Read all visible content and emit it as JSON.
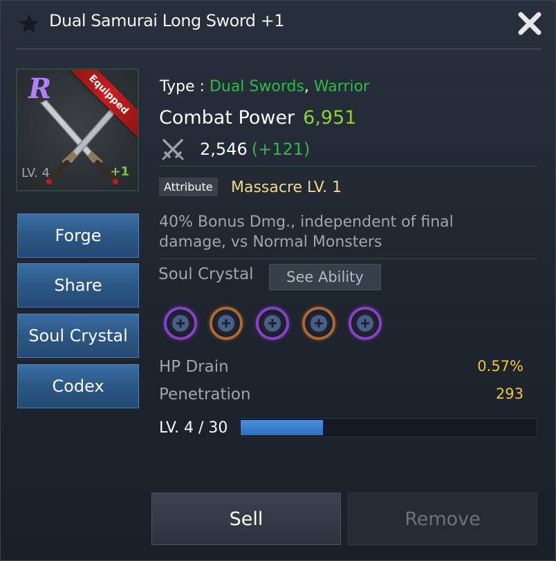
{
  "header": {
    "title": "Dual Samurai Long Sword +1"
  },
  "item": {
    "rarity": "R",
    "equipped_label": "Equipped",
    "level": "LV. 4",
    "enhance": "+1"
  },
  "left_buttons": [
    {
      "label": "Forge"
    },
    {
      "label": "Share"
    },
    {
      "label": "Soul Crystal"
    },
    {
      "label": "Codex"
    }
  ],
  "info": {
    "type_label": "Type :",
    "type_value": "Dual Swords",
    "type_separator": ",",
    "class_value": "Warrior",
    "combat_power_label": "Combat Power",
    "combat_power_value": "6,951",
    "attack_value": "2,546",
    "attack_bonus": "(+121)"
  },
  "attribute": {
    "badge": "Attribute",
    "value": "Massacre LV. 1",
    "description": "40% Bonus Dmg., independent of final damage, vs Normal Monsters"
  },
  "soul_crystal": {
    "label": "Soul Crystal",
    "see_ability_label": "See Ability",
    "slots": [
      "purple",
      "orange",
      "purple",
      "orange",
      "purple"
    ]
  },
  "stats": [
    {
      "name": "HP Drain",
      "value": "0.57%"
    },
    {
      "name": "Penetration",
      "value": "293"
    }
  ],
  "exp": {
    "label": "LV. 4 / 30",
    "progress": 0.28
  },
  "actions": {
    "sell_label": "Sell",
    "remove_label": "Remove"
  },
  "colors": {
    "accent_green": "#33b84a",
    "combat_green": "#8fd13b",
    "gold": "#f2c632",
    "button_blue": "#2c5785"
  }
}
